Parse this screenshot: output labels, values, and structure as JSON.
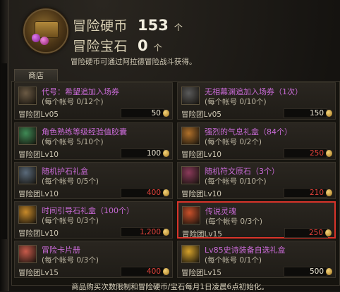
{
  "currency": {
    "coin_label": "冒险硬币",
    "coin_value": "153",
    "coin_unit": "个",
    "gem_label": "冒险宝石",
    "gem_value": "0",
    "gem_unit": "个",
    "hint": "冒险硬币可通过阿拉德冒险战斗获得。"
  },
  "shop": {
    "tab_label": "商店",
    "items": [
      {
        "name": "代号：希望追加入场券",
        "limit": "(每个帐号 0/12个)",
        "req": "冒险团Lv05",
        "price": "50",
        "price_color": "white",
        "icon": "ticket-icon",
        "icon_color": "#6b5a44"
      },
      {
        "name": "无相幕渊追加入场券（1次）",
        "limit": "(每个帐号 0/10个)",
        "req": "冒险团Lv05",
        "price": "150",
        "price_color": "white",
        "icon": "ticket-icon",
        "icon_color": "#5a5a5a"
      },
      {
        "name": "角色熟练等级经验值胶囊",
        "limit": "(每个帐号 5/10个)",
        "req": "冒险团Lv10",
        "price": "100",
        "price_color": "white",
        "icon": "exp-capsule-icon",
        "icon_color": "#3f8a55"
      },
      {
        "name": "强烈的气息礼盒（84个）",
        "limit": "(每个帐号 0/2个)",
        "req": "冒险团Lv10",
        "price": "250",
        "price_color": "red",
        "icon": "gift-box-icon",
        "icon_color": "#b0702a"
      },
      {
        "name": "随机护石礼盒",
        "limit": "(每个帐号 0/5个)",
        "req": "冒险团Lv10",
        "price": "400",
        "price_color": "red",
        "icon": "chest-icon",
        "icon_color": "#5a6a7a"
      },
      {
        "name": "随机符文原石（3个）",
        "limit": "(每个帐号 0/10个)",
        "req": "冒险团Lv10",
        "price": "210",
        "price_color": "red",
        "icon": "rune-stone-icon",
        "icon_color": "#8a3a5a"
      },
      {
        "name": "时间引导石礼盒（100个）",
        "limit": "(每个帐号 0/3个)",
        "req": "冒险团Lv10",
        "price": "1,200",
        "price_color": "red",
        "icon": "gift-box-icon",
        "icon_color": "#c88a2a"
      },
      {
        "name": "传说灵魂",
        "limit": "(每个帐号 0/3个)",
        "req": "冒险团Lv15",
        "price": "250",
        "price_color": "red",
        "icon": "soul-icon",
        "icon_color": "#c8502a"
      },
      {
        "name": "冒险卡片册",
        "limit": "(每个帐号 0/3个)",
        "req": "冒险团Lv15",
        "price": "400",
        "price_color": "red",
        "icon": "card-album-icon",
        "icon_color": "#c85a4a"
      },
      {
        "name": "Lv85史诗装备自选礼盒",
        "limit": "(每个帐号 0/1个)",
        "req": "冒险团Lv15",
        "price": "500",
        "price_color": "white",
        "icon": "gift-box-icon",
        "icon_color": "#d4a02a"
      }
    ]
  },
  "footer": "商品购买次数限制和冒险硬币/宝石每月1日凌晨6点初始化。"
}
